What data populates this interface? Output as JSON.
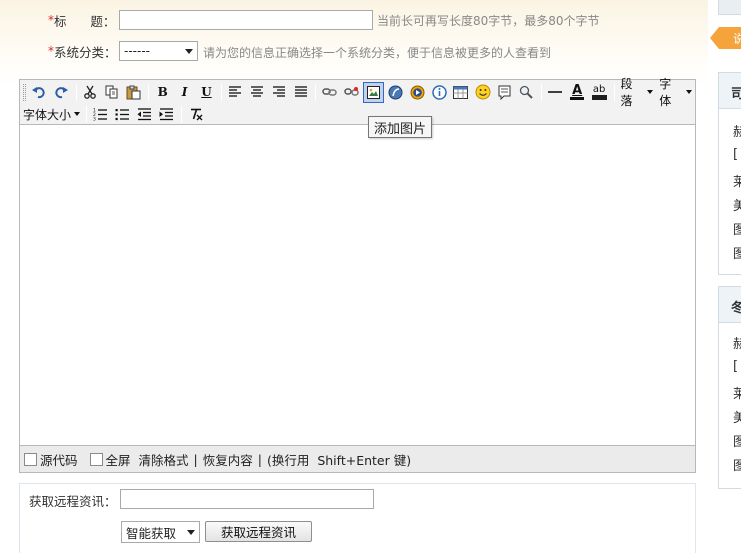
{
  "form": {
    "title_row": {
      "required_mark": "*",
      "label": "标      题：",
      "value": "",
      "hint": "当前长可再写长度80字节，最多80个字节"
    },
    "category_row": {
      "required_mark": "*",
      "label": "系统分类：",
      "selected": "------",
      "hint": "请为您的信息正确选择一个系统分类，便于信息被更多的人查看到"
    }
  },
  "editor": {
    "toolbar": {
      "row1_icons": [
        "undo-icon",
        "redo-icon",
        "cut-icon",
        "copy-icon",
        "paste-icon",
        "bold-icon",
        "italic-icon",
        "underline-icon",
        "align-left-icon",
        "align-center-icon",
        "align-right-icon",
        "align-justify-icon",
        "link-icon",
        "unlink-icon",
        "insert-image-icon",
        "flash-icon",
        "media-icon",
        "info-icon",
        "table-icon",
        "emoticon-icon",
        "code-icon",
        "find-icon",
        "horizontal-rule-icon",
        "font-color-icon",
        "highlight-icon"
      ],
      "bold": "B",
      "italic": "I",
      "underline": "U",
      "paragraph": "段落",
      "font": "字体",
      "font_size": "字体大小",
      "font_color_glyph": "A",
      "highlight_glyph": "ab",
      "row2_icons": [
        "ordered-list-icon",
        "unordered-list-icon",
        "outdent-icon",
        "indent-icon",
        "remove-format-icon"
      ]
    },
    "tooltip": "添加图片",
    "content": "",
    "statusbar": {
      "source_code": "源代码",
      "fullscreen": "全屏",
      "clear_format": "清除格式",
      "separator": "|",
      "restore_content": "恢复内容",
      "shortcut_hint": "(换行用  Shift+Enter 键)"
    }
  },
  "remote": {
    "label": "获取远程资讯：",
    "url_value": "",
    "mode_selected": "智能获取",
    "fetch_button": "获取远程资讯"
  },
  "sidebar": {
    "box1_partial_head": "司",
    "box1_items": [
      "赫",
      "[",
      "莱",
      "美",
      "图",
      "图"
    ],
    "box2_partial_head": "冬",
    "box2_items": [
      "赫",
      "[",
      "莱",
      "美",
      "图",
      "图"
    ],
    "tab_badge": "说"
  },
  "colors": {
    "required": "#e0262a",
    "accent_orange": "#f4a43a",
    "toolbar_bg": "#f2f2f2"
  }
}
